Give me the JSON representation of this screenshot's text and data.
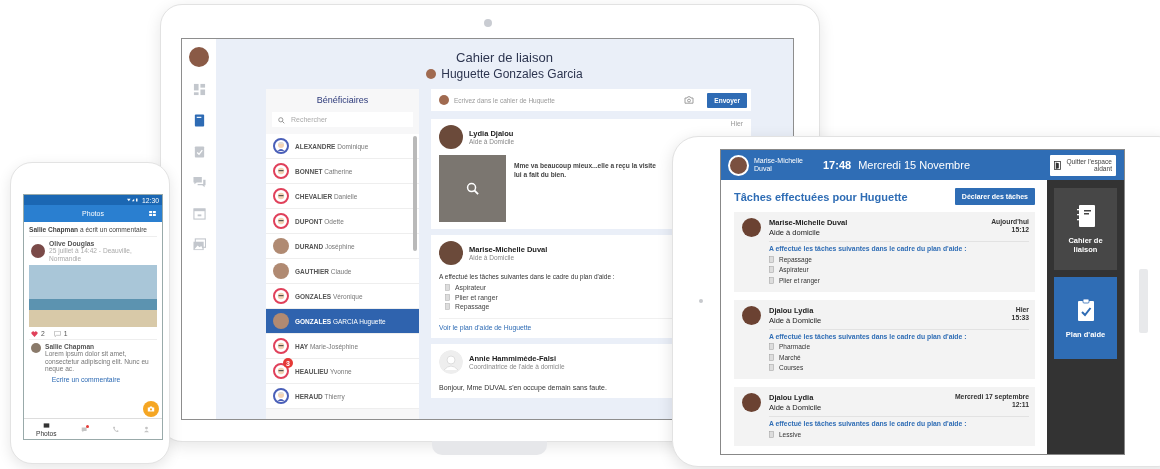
{
  "phone": {
    "status_time": "12:30",
    "title": "Photos",
    "notice": "**Sallie Chapman** a écrit un commentaire",
    "post": {
      "author": "Olive Douglas",
      "meta": "25 juillet à 14:42 - Deauville, Normandie",
      "likes": "2",
      "comments": "1"
    },
    "comment": {
      "author": "Sallie Chapman",
      "text": "Lorem ipsum dolor sit amet, consectetur adipiscing elit. Nunc eu neque ac."
    },
    "comment_link": "Ecrire un commentaire",
    "nav": [
      {
        "kind": "photos",
        "label": "Photos",
        "selected": true,
        "badge": false
      },
      {
        "kind": "messages",
        "selected": false,
        "badge": true
      },
      {
        "kind": "calls",
        "selected": false,
        "badge": false
      },
      {
        "kind": "profile",
        "selected": false,
        "badge": false
      }
    ]
  },
  "laptop": {
    "sidebar": [
      {
        "kind": "dashboard",
        "selected": false
      },
      {
        "kind": "notebook",
        "selected": true
      },
      {
        "kind": "tasks",
        "selected": false
      },
      {
        "kind": "chat",
        "selected": false
      },
      {
        "kind": "calendar",
        "selected": false
      },
      {
        "kind": "gallery",
        "selected": false
      }
    ],
    "header": {
      "title": "Cahier de liaison",
      "subject": "Huguette Gonzales Garcia"
    },
    "beneficiaries": {
      "title": "Bénéficiaires",
      "search": {
        "placeholder": "Rechercher"
      },
      "items": [
        {
          "surname": "ALEXANDRE",
          "first_name": "Dominique",
          "kind": "male",
          "selected": false
        },
        {
          "surname": "BONNET",
          "first_name": "Catherine",
          "kind": "female",
          "selected": false
        },
        {
          "surname": "CHEVALIER",
          "first_name": "Danielle",
          "kind": "female",
          "selected": false
        },
        {
          "surname": "DUPONT",
          "first_name": "Odette",
          "kind": "female",
          "selected": false
        },
        {
          "surname": "DURAND",
          "first_name": "Joséphine",
          "kind": "photo",
          "selected": false
        },
        {
          "surname": "GAUTHIER",
          "first_name": "Claude",
          "kind": "photo",
          "selected": false
        },
        {
          "surname": "GONZALES",
          "first_name": "Véronique",
          "kind": "female",
          "selected": false
        },
        {
          "surname": "GONZALES",
          "first_name": "GARCIA Huguette",
          "kind": "photo",
          "selected": true
        },
        {
          "surname": "HAY",
          "first_name": "Marie-Joséphine",
          "kind": "female",
          "selected": false
        },
        {
          "surname": "HEAULIEU",
          "first_name": "Yvonne",
          "kind": "female",
          "selected": false,
          "badge": "3"
        },
        {
          "surname": "HERAUD",
          "first_name": "Thierry",
          "kind": "male",
          "selected": false
        }
      ]
    },
    "composer": {
      "placeholder": "Ecrivez dans le cahier de Huguette",
      "button": "Envoyer"
    },
    "posts": [
      {
        "kind": "photo",
        "author": "Lydia Djalou",
        "role": "Aide à Domicile",
        "time": "Hier",
        "lines": [
          "Mme va beaucoup mieux...elle a reçu la visite",
          "lui a fait du bien."
        ]
      },
      {
        "kind": "tasks",
        "author": "Marise-Michelle Duval",
        "role": "Aide à Domicile",
        "intro": "A effectué les tâches suivantes dans le cadre du plan d'aide :",
        "tasks": [
          "Aspirateur",
          "Plier et ranger",
          "Repassage"
        ],
        "link": "Voir le plan d'aide de Huguette"
      },
      {
        "kind": "message",
        "author": "Annie Hammimède-Falsi",
        "role": "Coordinatrice de l'aide à domicile",
        "text": "Bonjour, Mme DUVAL s'en occupe demain sans faute."
      }
    ]
  },
  "tablet": {
    "user": "Marise-Michelle Duval",
    "time": "17:48",
    "date": "Mercredi 15 Novembre",
    "quit_button": "Quitter l'espace aidant",
    "title": "Tâches effectuées pour Huguette",
    "declare_button": "Déclarer des tâches",
    "entries": [
      {
        "author": "Marise-Michelle Duval",
        "role": "Aide à domicile",
        "date": "Aujourd'hui",
        "time": "15:12",
        "intro": "A effectué les tâches suivantes dans le cadre du plan d'aide :",
        "tasks": [
          "Repassage",
          "Aspirateur",
          "Plier et ranger"
        ]
      },
      {
        "author": "Djalou Lydia",
        "role": "Aide à Domicile",
        "date": "Hier",
        "time": "15:33",
        "intro": "A effectué les tâches suivantes dans le cadre du plan d'aide :",
        "tasks": [
          "Pharmacie",
          "Marché",
          "Courses"
        ]
      },
      {
        "author": "Djalou Lydia",
        "role": "Aide à Domicile",
        "date": "Mercredi 17 septembre",
        "time": "12:11",
        "intro": "A effectué les tâches suivantes dans le cadre du plan d'aide :",
        "tasks": [
          "Lessive"
        ]
      }
    ],
    "rail": [
      {
        "kind": "notebook",
        "label": "Cahier de liaison",
        "selected": false
      },
      {
        "kind": "plan",
        "label": "Plan d'aide",
        "selected": true
      }
    ]
  }
}
